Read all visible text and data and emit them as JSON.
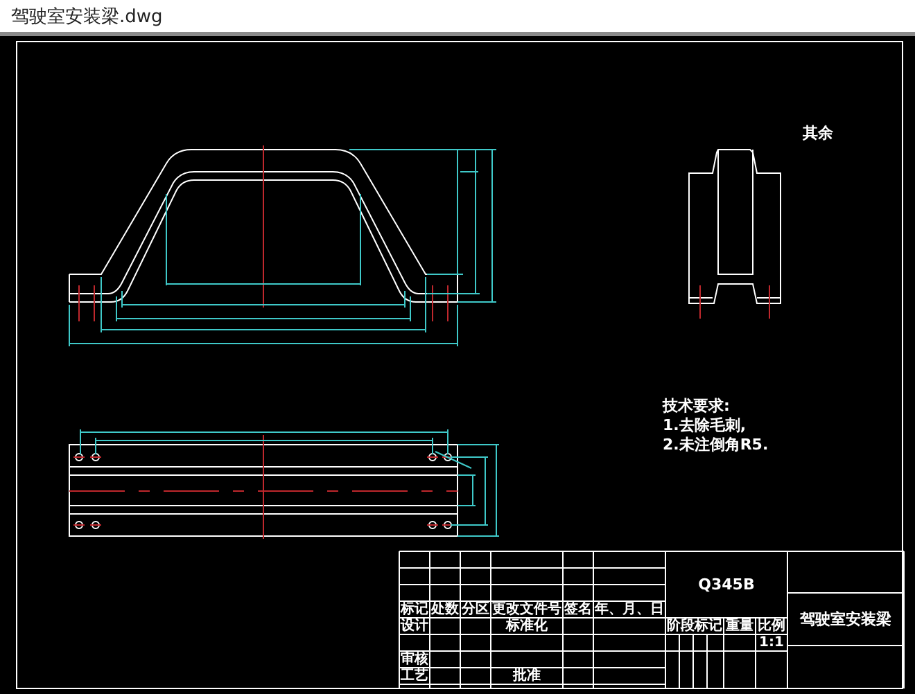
{
  "window": {
    "title": "驾驶室安装梁.dwg"
  },
  "drawing": {
    "surface_note": "其余",
    "requirements": {
      "heading": "技术要求:",
      "items": [
        "1.去除毛刺,",
        "2.未注倒角R5."
      ]
    }
  },
  "title_block": {
    "revision_headers": [
      "标记",
      "处数",
      "分区",
      "更改文件号",
      "签名",
      "年、月、日"
    ],
    "designer_label": "设计",
    "standardization_label": "标准化",
    "review_label": "审核",
    "process_label": "工艺",
    "approval_label": "批准",
    "material": "Q345B",
    "stage_label": "阶段标记",
    "weight_label": "重量",
    "scale_label": "比例",
    "scale": "1:1",
    "part_name": "驾驶室安装梁"
  }
}
